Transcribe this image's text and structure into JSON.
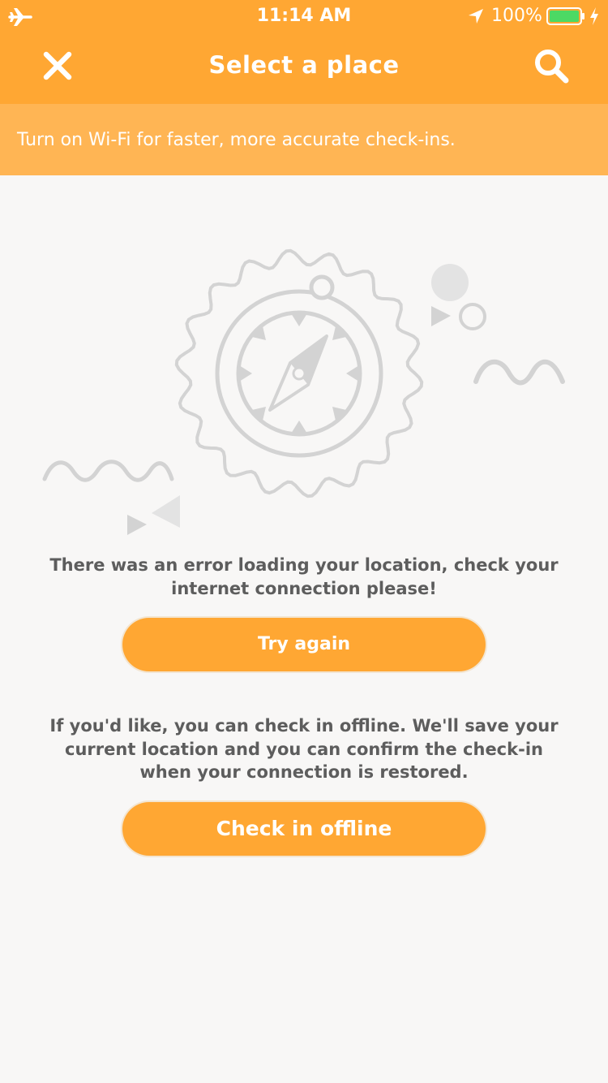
{
  "status_bar": {
    "time": "11:14 AM",
    "battery_percent": "100%",
    "battery_level": 1.0,
    "icons": [
      "airplane-icon",
      "location-arrow-icon",
      "battery-icon",
      "bolt-icon"
    ]
  },
  "nav": {
    "title": "Select a place",
    "close_icon": "close-icon",
    "search_icon": "search-icon"
  },
  "banner": {
    "text": "Turn on Wi-Fi for faster, more accurate check-ins."
  },
  "error": {
    "message": "There was an error loading your location, check your internet connection please!",
    "retry_label": "Try again"
  },
  "offline": {
    "message": "If you'd like, you can check in offline. We'll save your current location and you can confirm the check-in when your connection is restored.",
    "button_label": "Check in offline"
  },
  "colors": {
    "accent": "#ffa733",
    "banner": "#ffb554",
    "background": "#f8f7f6",
    "text": "#5d5d5d",
    "illustration": "#d3d3d3"
  }
}
